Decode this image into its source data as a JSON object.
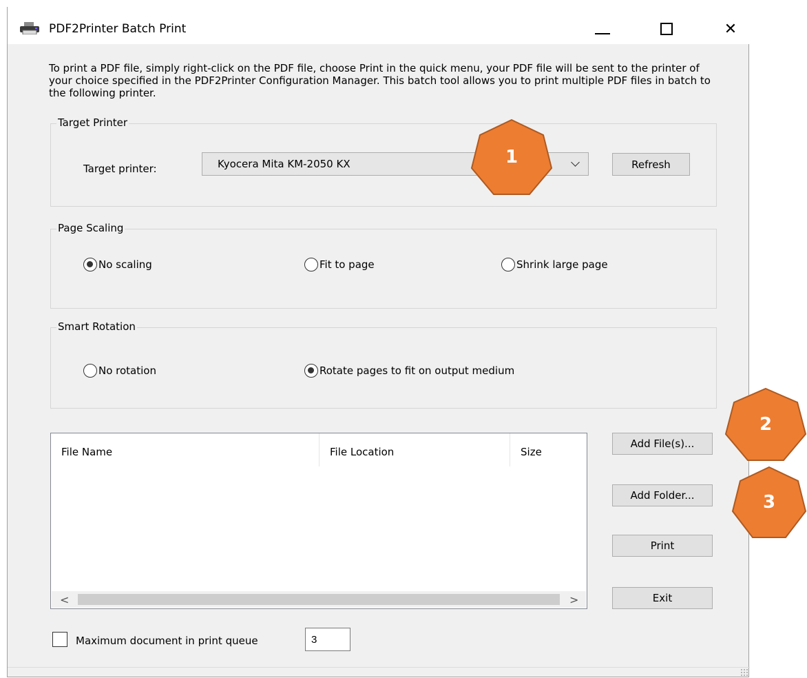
{
  "window": {
    "title": "PDF2Printer Batch Print",
    "icon": "printer-icon",
    "controls": {
      "minimize": "minimize-icon",
      "maximize": "maximize-icon",
      "close": "close-icon",
      "close_glyph": "✕"
    }
  },
  "intro_text": "To print a PDF file, simply right-click on the PDF file, choose Print in the quick menu, your PDF file will be sent to the printer of your choice specified in the PDF2Printer Configuration Manager. This batch tool allows you to print multiple PDF files in batch to the following printer.",
  "target_printer": {
    "group_title": "Target Printer",
    "label": "Target printer:",
    "selected": "Kyocera Mita KM-2050 KX",
    "refresh_label": "Refresh"
  },
  "page_scaling": {
    "group_title": "Page Scaling",
    "options": [
      {
        "label": "No scaling",
        "checked": true
      },
      {
        "label": "Fit to page",
        "checked": false
      },
      {
        "label": "Shrink large page",
        "checked": false
      }
    ]
  },
  "smart_rotation": {
    "group_title": "Smart Rotation",
    "options": [
      {
        "label": "No rotation",
        "checked": false
      },
      {
        "label": "Rotate pages to fit on output medium",
        "checked": true
      }
    ]
  },
  "file_list": {
    "columns": [
      "File Name",
      "File Location",
      "Size"
    ],
    "rows": [],
    "scroll_left": "<",
    "scroll_right": ">"
  },
  "actions": {
    "add_files": "Add File(s)...",
    "add_folder": "Add Folder...",
    "print": "Print",
    "exit": "Exit"
  },
  "queue": {
    "label": "Maximum document in print queue",
    "checked": false,
    "value": "3"
  },
  "annotations": [
    "1",
    "2",
    "3"
  ],
  "colors": {
    "badge_fill": "#ed7d31",
    "badge_stroke": "#ae5a21"
  }
}
